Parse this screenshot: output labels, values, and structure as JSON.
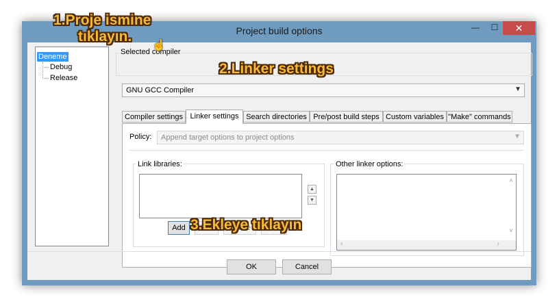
{
  "window": {
    "title": "Project build options",
    "minimize_glyph": "—",
    "maximize_glyph": "☐",
    "close_glyph": "✕"
  },
  "tree": {
    "root": "Deneme",
    "children": [
      "Debug",
      "Release"
    ]
  },
  "compiler_group": {
    "legend": "Selected compiler",
    "selected": "GNU GCC Compiler"
  },
  "tabs": [
    "Compiler settings",
    "Linker settings",
    "Search directories",
    "Pre/post build steps",
    "Custom variables",
    "\"Make\" commands"
  ],
  "active_tab": "Linker settings",
  "policy": {
    "label": "Policy:",
    "value": "Append target options to project options"
  },
  "link_libraries": {
    "legend": "Link libraries:",
    "buttons": {
      "add": "Add",
      "edit": "Edit",
      "delete": "Delete",
      "clear": "Clear"
    }
  },
  "other_linker": {
    "legend": "Other linker options:"
  },
  "footer": {
    "ok": "OK",
    "cancel": "Cancel"
  },
  "annotations": {
    "step1_line1": "1.Proje ismine",
    "step1_line2": "tıklayın.",
    "step2": "2.Linker settings",
    "step3": "3.Ekleye tıklayın"
  },
  "colors": {
    "accent": "#3399ff",
    "window_frame": "#6f9bc1",
    "close_button": "#c74b4b",
    "annotation_fill": "#f8b83a",
    "annotation_outline": "#4a2a08"
  }
}
